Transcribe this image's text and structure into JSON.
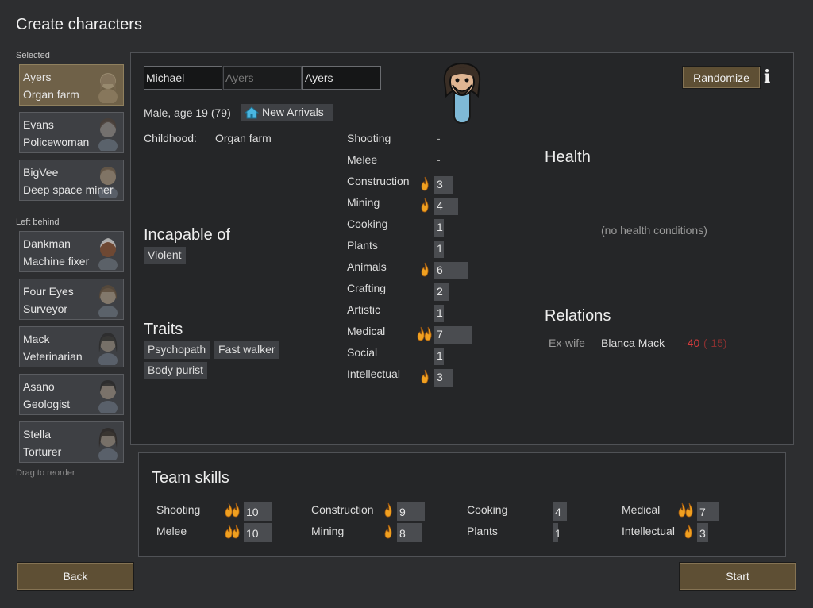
{
  "title": "Create characters",
  "groups": {
    "selected": "Selected",
    "left_behind": "Left behind",
    "drag_hint": "Drag to reorder"
  },
  "selected_pawns": [
    {
      "name": "Ayers",
      "role": "Organ farm"
    },
    {
      "name": "Evans",
      "role": "Policewoman"
    },
    {
      "name": "BigVee",
      "role": "Deep space miner"
    }
  ],
  "left_behind_pawns": [
    {
      "name": "Dankman",
      "role": "Machine fixer"
    },
    {
      "name": "Four Eyes",
      "role": "Surveyor"
    },
    {
      "name": "Mack",
      "role": "Veterinarian"
    },
    {
      "name": "Asano",
      "role": "Geologist"
    },
    {
      "name": "Stella",
      "role": "Torturer"
    }
  ],
  "character": {
    "first_name": "Michael",
    "nick_placeholder": "Ayers",
    "last_name": "Ayers",
    "summary": "Male, age 19 (79)",
    "faction": "New Arrivals",
    "childhood_label": "Childhood:",
    "childhood_value": "Organ farm",
    "incapable_heading": "Incapable of",
    "incapable": [
      "Violent"
    ],
    "traits_heading": "Traits",
    "traits": [
      "Psychopath",
      "Fast walker",
      "Body purist"
    ]
  },
  "buttons": {
    "randomize": "Randomize",
    "back": "Back",
    "start": "Start"
  },
  "skills": [
    {
      "name": "Shooting",
      "value": "-",
      "passion": 0
    },
    {
      "name": "Melee",
      "value": "-",
      "passion": 0
    },
    {
      "name": "Construction",
      "value": "3",
      "passion": 1
    },
    {
      "name": "Mining",
      "value": "4",
      "passion": 1
    },
    {
      "name": "Cooking",
      "value": "1",
      "passion": 0
    },
    {
      "name": "Plants",
      "value": "1",
      "passion": 0
    },
    {
      "name": "Animals",
      "value": "6",
      "passion": 1
    },
    {
      "name": "Crafting",
      "value": "2",
      "passion": 0
    },
    {
      "name": "Artistic",
      "value": "1",
      "passion": 0
    },
    {
      "name": "Medical",
      "value": "7",
      "passion": 2
    },
    {
      "name": "Social",
      "value": "1",
      "passion": 0
    },
    {
      "name": "Intellectual",
      "value": "3",
      "passion": 1
    }
  ],
  "health": {
    "heading": "Health",
    "empty": "(no health conditions)"
  },
  "relations": {
    "heading": "Relations",
    "items": [
      {
        "relation": "Ex-wife",
        "name": "Blanca Mack",
        "opinion": "-40",
        "opinion_other": "(-15)"
      }
    ]
  },
  "team": {
    "heading": "Team skills",
    "skills": [
      {
        "name": "Shooting",
        "value": "10",
        "passion": 2
      },
      {
        "name": "Melee",
        "value": "10",
        "passion": 2
      },
      {
        "name": "Construction",
        "value": "9",
        "passion": 1
      },
      {
        "name": "Mining",
        "value": "8",
        "passion": 1
      },
      {
        "name": "Cooking",
        "value": "4",
        "passion": 0
      },
      {
        "name": "Plants",
        "value": "1",
        "passion": 0
      },
      {
        "name": "Medical",
        "value": "7",
        "passion": 2
      },
      {
        "name": "Intellectual",
        "value": "3",
        "passion": 1
      }
    ]
  },
  "colors": {
    "button": "#5e4f34",
    "selected_card": "#6f6148",
    "passion": "#f0a020",
    "negative": "#d23c3c"
  },
  "icons": {
    "faction": "house-icon",
    "info": "info-icon",
    "passion": "flame-icon"
  }
}
